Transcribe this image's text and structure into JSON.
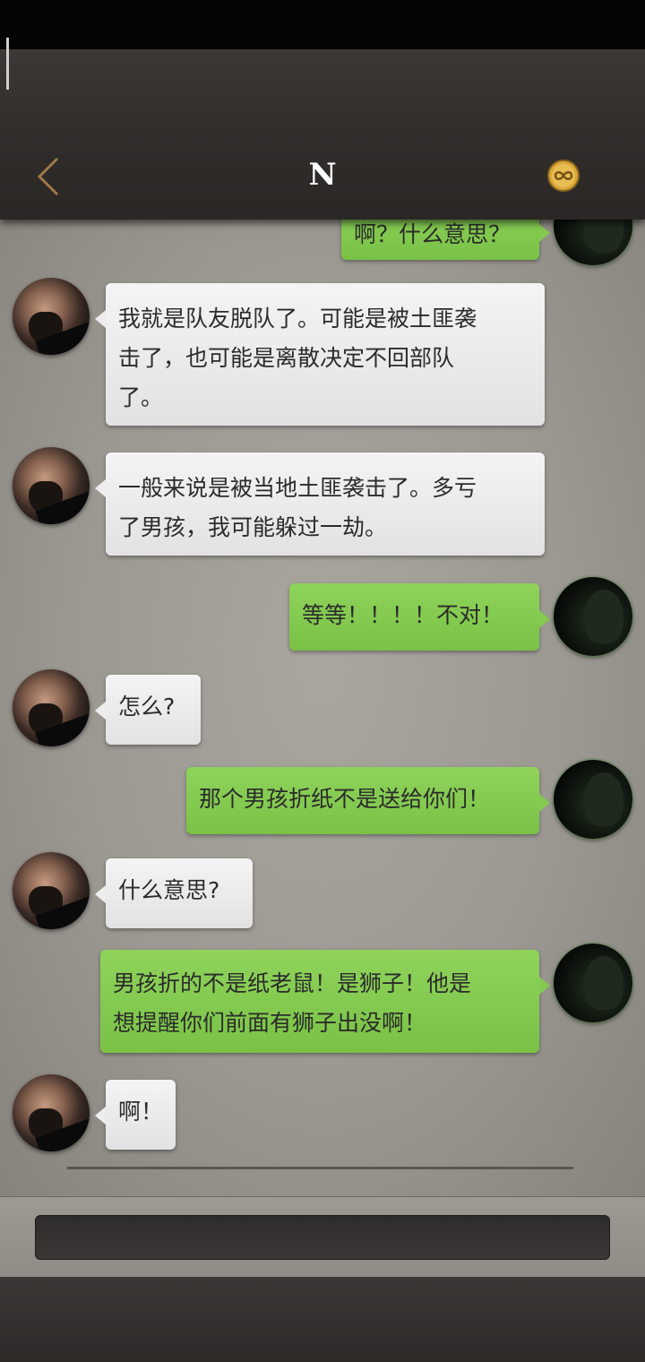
{
  "header": {
    "title": "N",
    "back_icon": "chevron-left-icon",
    "hint_icon": "infinity-coin-icon"
  },
  "colors": {
    "header_bg": "#2f2c2a",
    "chat_bg": "#9b9791",
    "bubble_left": "#ececec",
    "bubble_right": "#84ca50",
    "back_icon": "#a0784a",
    "hint_icon": "#d9a73a"
  },
  "messages": [
    {
      "side": "right",
      "lines": [
        "啊？什么意思？"
      ]
    },
    {
      "side": "left",
      "lines": [
        "我就是队友脱队了。可能是被土匪袭",
        "击了，也可能是离散决定不回部队",
        "了。"
      ]
    },
    {
      "side": "left",
      "lines": [
        "一般来说是被当地土匪袭击了。多亏",
        "了男孩，我可能躲过一劫。"
      ]
    },
    {
      "side": "right",
      "lines": [
        "等等！！！！不对！"
      ]
    },
    {
      "side": "left",
      "lines": [
        "怎么?"
      ]
    },
    {
      "side": "right",
      "lines": [
        "那个男孩折纸不是送给你们！"
      ]
    },
    {
      "side": "left",
      "lines": [
        "什么意思?"
      ]
    },
    {
      "side": "right",
      "lines": [
        "男孩折的不是纸老鼠！是狮子！他是",
        "想提醒你们前面有狮子出没啊！"
      ]
    },
    {
      "side": "left",
      "lines": [
        "啊！"
      ]
    }
  ],
  "input": {
    "placeholder": ""
  }
}
